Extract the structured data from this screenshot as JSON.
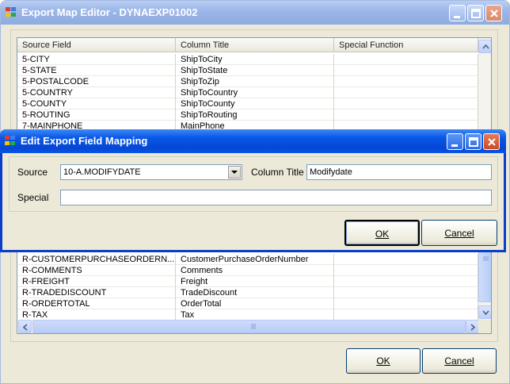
{
  "main_window": {
    "title": "Export Map Editor - DYNAEXP01002",
    "ok_label": "OK",
    "cancel_label": "Cancel"
  },
  "grid": {
    "columns": [
      "Source Field",
      "Column Title",
      "Special Function"
    ],
    "top_rows": [
      [
        "5-CITY",
        "ShipToCity",
        ""
      ],
      [
        "5-STATE",
        "ShipToState",
        ""
      ],
      [
        "5-POSTALCODE",
        "ShipToZip",
        ""
      ],
      [
        "5-COUNTRY",
        "ShipToCountry",
        ""
      ],
      [
        "5-COUNTY",
        "ShipToCounty",
        ""
      ],
      [
        "5-ROUTING",
        "ShipToRouting",
        ""
      ],
      [
        "7-MAINPHONE",
        "MainPhone",
        ""
      ]
    ],
    "bottom_rows": [
      [
        "R-CUSTOMERPURCHASEORDERN...",
        "CustomerPurchaseOrderNumber",
        ""
      ],
      [
        "R-COMMENTS",
        "Comments",
        ""
      ],
      [
        "R-FREIGHT",
        "Freight",
        ""
      ],
      [
        "R-TRADEDISCOUNT",
        "TradeDiscount",
        ""
      ],
      [
        "R-ORDERTOTAL",
        "OrderTotal",
        ""
      ],
      [
        "R-TAX",
        "Tax",
        ""
      ]
    ]
  },
  "dialog": {
    "title": "Edit Export Field Mapping",
    "source_label": "Source",
    "source_value": "10-A.MODIFYDATE",
    "column_title_label": "Column Title",
    "column_title_value": "Modifydate",
    "special_label": "Special",
    "special_value": "",
    "ok_label": "OK",
    "cancel_label": "Cancel"
  },
  "colors": {
    "title_inactive": "#9db9eb",
    "title_active": "#0a58e6",
    "close_red": "#d9532c",
    "dialog_bg": "#ece9d8"
  }
}
